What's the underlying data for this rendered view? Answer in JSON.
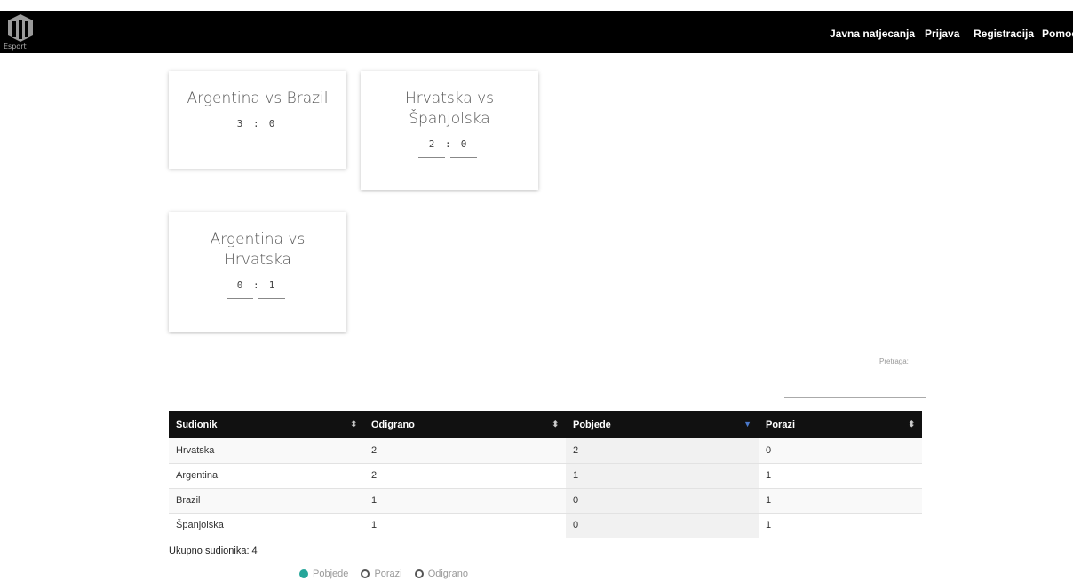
{
  "header": {
    "logo_text": "Esport",
    "nav": [
      "Javna natjecanja",
      "Prijava",
      "Registracija",
      "Pomoć"
    ]
  },
  "matches": [
    {
      "title": "Argentina vs Brazil",
      "score_a": "3",
      "score_b": "0"
    },
    {
      "title": "Hrvatska vs Španjolska",
      "score_a": "2",
      "score_b": "0"
    },
    {
      "title": "Argentina vs Hrvatska",
      "score_a": "0",
      "score_b": "1"
    }
  ],
  "search": {
    "label": "Pretraga:"
  },
  "table": {
    "headers": [
      "Sudionik",
      "Odigrano",
      "Pobjede",
      "Porazi"
    ],
    "rows": [
      [
        "Hrvatska",
        "2",
        "2",
        "0"
      ],
      [
        "Argentina",
        "2",
        "1",
        "1"
      ],
      [
        "Brazil",
        "1",
        "0",
        "1"
      ],
      [
        "Španjolska",
        "1",
        "0",
        "1"
      ]
    ]
  },
  "total_text": "Ukupno sudionika: 4",
  "legend": [
    "Pobjede",
    "Porazi",
    "Odigrano"
  ],
  "colors": {
    "topbar": "#000000",
    "legend_active": "#26a69a",
    "sort_active": "#4a78c9"
  }
}
